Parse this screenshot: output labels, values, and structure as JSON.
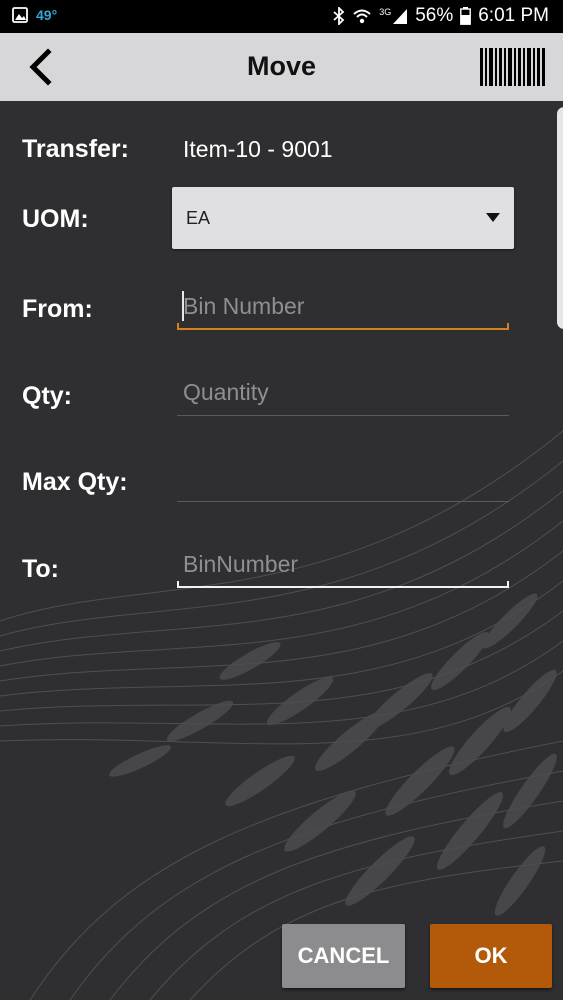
{
  "statusbar": {
    "temperature": "49°",
    "network": "3G",
    "battery": "56%",
    "time": "6:01 PM"
  },
  "appbar": {
    "title": "Move",
    "back_icon": "chevron-left-icon",
    "barcode_icon": "barcode-icon"
  },
  "form": {
    "transfer_label": "Transfer:",
    "transfer_value": "Item-10 - 9001",
    "uom_label": "UOM:",
    "uom_value": "EA",
    "from_label": "From:",
    "from_placeholder": "Bin Number",
    "from_value": "",
    "qty_label": "Qty:",
    "qty_placeholder": "Quantity",
    "qty_value": "",
    "max_qty_label": "Max Qty:",
    "max_qty_value": "",
    "to_label": "To:",
    "to_placeholder": "BinNumber",
    "to_value": ""
  },
  "actions": {
    "cancel_label": "CANCEL",
    "ok_label": "OK"
  },
  "colors": {
    "accent": "#d4811f",
    "ok_button": "#b25a0a",
    "cancel_button": "#8c8c8e",
    "appbar": "#d7d7d9",
    "background": "#2f2f31"
  }
}
